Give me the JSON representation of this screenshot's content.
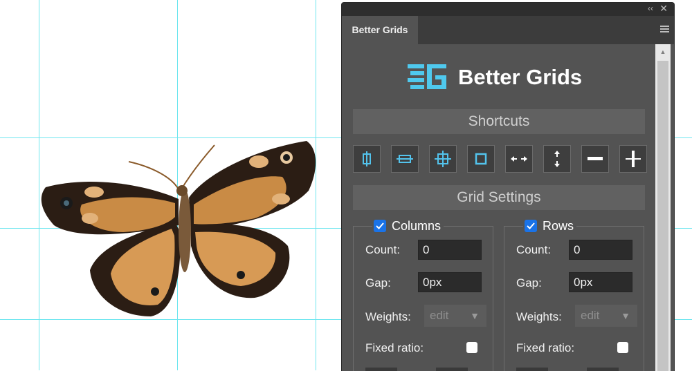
{
  "panel": {
    "tab_label": "Better Grids",
    "brand_title": "Better Grids",
    "collapse_glyph": "‹‹",
    "close_glyph": "✕",
    "scroll_up_glyph": "▲"
  },
  "shortcuts": {
    "header": "Shortcuts",
    "buttons": [
      "center-vertical-guide",
      "center-horizontal-guide",
      "center-cross-guides",
      "margin-box-guides",
      "horizontal-arrows",
      "vertical-arrows",
      "horizontal-line",
      "vertical-line"
    ]
  },
  "grid_settings": {
    "header": "Grid Settings",
    "columns": {
      "label": "Columns",
      "checked": true,
      "count_label": "Count:",
      "count_value": "0",
      "gap_label": "Gap:",
      "gap_value": "0px",
      "weights_label": "Weights:",
      "weights_value": "edit",
      "fixed_ratio_label": "Fixed ratio:",
      "fixed_ratio_checked": false
    },
    "rows": {
      "label": "Rows",
      "checked": true,
      "count_label": "Count:",
      "count_value": "0",
      "gap_label": "Gap:",
      "gap_value": "0px",
      "weights_label": "Weights:",
      "weights_value": "edit",
      "fixed_ratio_label": "Fixed ratio:",
      "fixed_ratio_checked": false
    }
  },
  "colors": {
    "guide": "#6ee6ef",
    "panel_bg": "#535353",
    "logo": "#4fc9ee",
    "checkbox_accent": "#1a73e8",
    "shortcut_icon": "#53c3ec"
  }
}
